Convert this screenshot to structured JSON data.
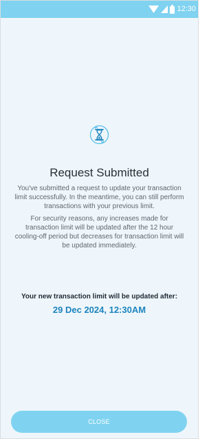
{
  "status_bar": {
    "time": "12:30"
  },
  "dialog": {
    "title": "Request Submitted",
    "message_1": "You've submitted a request to update your transaction limit successfully. In the meantime, you can still perform transactions with your previous limit.",
    "message_2": "For security reasons, any increases made for transaction limit will be updated after the 12 hour cooling-off period but decreases for transaction limit will be updated immediately.",
    "update_label": "Your new transaction limit will be updated after:",
    "update_datetime": "29 Dec 2024, 12:30AM"
  },
  "actions": {
    "close_label": "CLOSE"
  },
  "colors": {
    "background": "#EEF6FB",
    "status_bar": "#7FD2F0",
    "accent": "#1D84BD",
    "button": "#7FD3F0"
  },
  "icons": {
    "wifi": "wifi-icon",
    "signal": "signal-icon",
    "battery": "battery-icon",
    "request": "hourglass-icon"
  }
}
